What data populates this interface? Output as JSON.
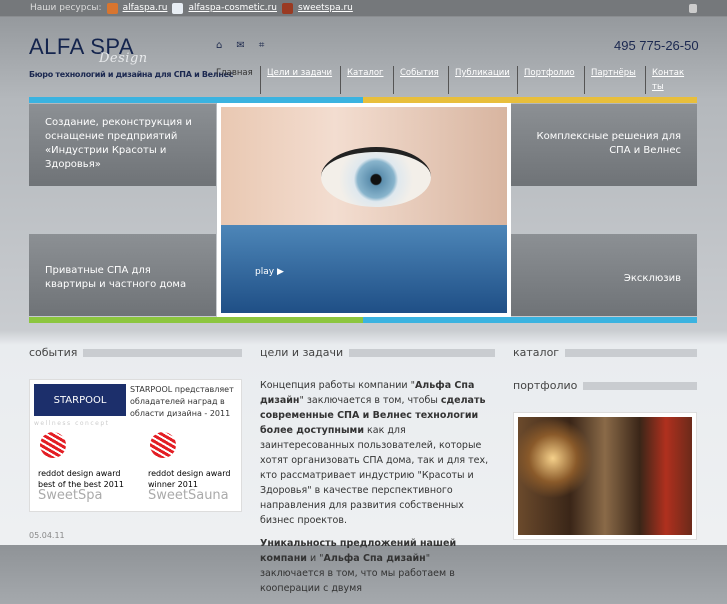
{
  "topbar": {
    "label": "Наши ресурсы:",
    "links": [
      "alfaspa.ru",
      "alfaspa-cosmetic.ru",
      "sweetspa.ru"
    ]
  },
  "header": {
    "logo": "ALFA SPA",
    "logo_sub": "Design",
    "tagline": "Бюро технологий и дизайна для СПА и Велнес",
    "phone": "495 775-26-50"
  },
  "nav": [
    "Главная",
    "Цели и задачи",
    "Каталог",
    "События",
    "Публикации",
    "Портфолио",
    "Партнёры",
    "Контакты"
  ],
  "tiles": {
    "tl": "Создание, реконструкция и оснащение предприятий «Индустрии Красоты и Здоровья»",
    "tr": "Комплексные решения для СПА и Велнес",
    "bl": "Приватные СПА для квартиры и частного дома",
    "br": "Эксклюзив",
    "play": "play"
  },
  "colors": {
    "blue": "#3bb3e0",
    "yellow": "#e8bf3c",
    "green": "#8cc63f"
  },
  "events": {
    "title": "события",
    "promo": {
      "brand": "STARPOOL",
      "text": "STARPOOL представляет обладателей наград в области дизайна - 2011",
      "concept": "wellness concept",
      "award1": "reddot design award",
      "award1_sub": "best of the best 2011",
      "award1_brand": "SweetSpa",
      "award2": "reddot design award",
      "award2_sub": "winner 2011",
      "award2_brand": "SweetSauna"
    },
    "date": "05.04.11"
  },
  "goals": {
    "title": "цели и задачи",
    "p1a": "Концепция работы компании \"",
    "p1b": "Альфа Спа дизайн",
    "p1c": "\" заключается в том, чтобы ",
    "p1d": "сделать современные СПА и Велнес технологии более доступными",
    "p1e": " как для заинтересованных пользователей, которые хотят организовать СПА дома, так и  для тех, кто рассматривает индустрию \"Красоты и Здоровья\" в качестве перспективного направления для развития собственных бизнес проектов.",
    "p2a": "Уникальность предложений нашей компани",
    "p2b": " и \"",
    "p2c": "Альфа Спа дизайн",
    "p2d": "\" заключается в том, что мы работаем в кооперации с двумя"
  },
  "catalog": {
    "title": "каталог"
  },
  "portfolio": {
    "title": "портфолио"
  }
}
